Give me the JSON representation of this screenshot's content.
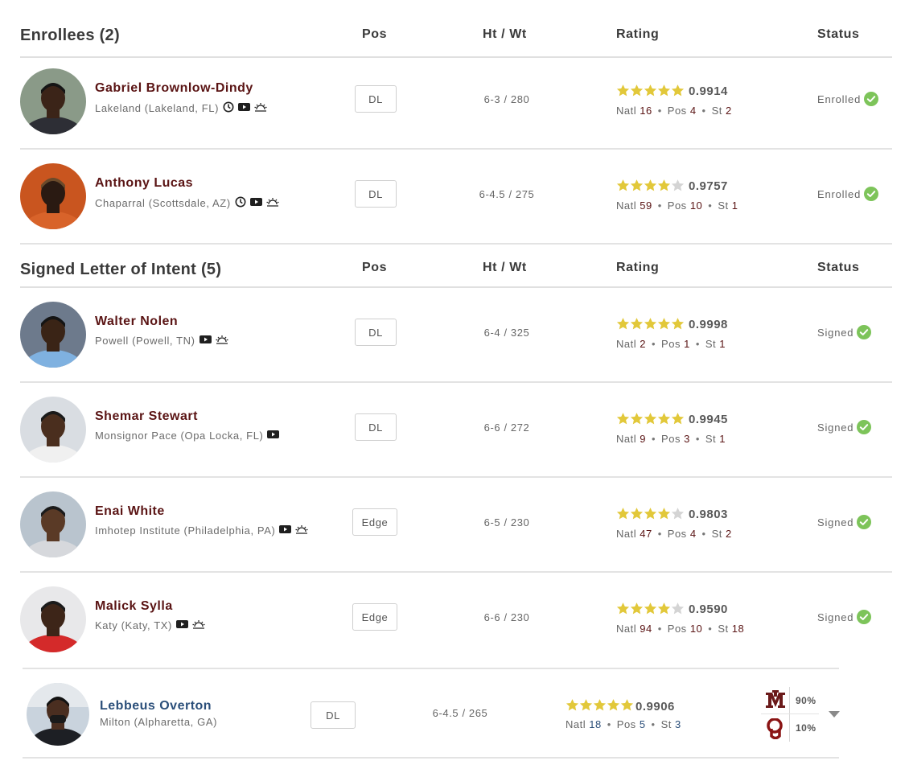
{
  "sections": [
    {
      "title": "Enrollees (2)",
      "columns": {
        "pos": "Pos",
        "htwt": "Ht / Wt",
        "rating": "Rating",
        "status": "Status"
      }
    },
    {
      "title": "Signed Letter of Intent (5)",
      "columns": {
        "pos": "Pos",
        "htwt": "Ht / Wt",
        "rating": "Rating",
        "status": "Status"
      }
    }
  ],
  "players": [
    {
      "name": "Gabriel Brownlow-Dindy",
      "school": "Lakeland (Lakeland, FL)",
      "icons": [
        "clock-icon",
        "video-icon",
        "sunrise-icon"
      ],
      "pos": "DL",
      "htwt": "6-3 / 280",
      "stars": 5,
      "score": "0.9914",
      "natl_label": "Natl",
      "natl": "16",
      "pos_label": "Pos",
      "pos_rank": "4",
      "st_label": "St",
      "st": "2",
      "status": "Enrolled"
    },
    {
      "name": "Anthony Lucas",
      "school": "Chaparral (Scottsdale, AZ)",
      "icons": [
        "clock-icon",
        "video-icon",
        "sunrise-icon"
      ],
      "pos": "DL",
      "htwt": "6-4.5 / 275",
      "stars": 4,
      "score": "0.9757",
      "natl_label": "Natl",
      "natl": "59",
      "pos_label": "Pos",
      "pos_rank": "10",
      "st_label": "St",
      "st": "1",
      "status": "Enrolled"
    },
    {
      "name": "Walter Nolen",
      "school": "Powell (Powell, TN)",
      "icons": [
        "video-icon",
        "sunrise-icon"
      ],
      "pos": "DL",
      "htwt": "6-4 / 325",
      "stars": 5,
      "score": "0.9998",
      "natl_label": "Natl",
      "natl": "2",
      "pos_label": "Pos",
      "pos_rank": "1",
      "st_label": "St",
      "st": "1",
      "status": "Signed"
    },
    {
      "name": "Shemar Stewart",
      "school": "Monsignor Pace (Opa Locka, FL)",
      "icons": [
        "video-icon"
      ],
      "pos": "DL",
      "htwt": "6-6 / 272",
      "stars": 5,
      "score": "0.9945",
      "natl_label": "Natl",
      "natl": "9",
      "pos_label": "Pos",
      "pos_rank": "3",
      "st_label": "St",
      "st": "1",
      "status": "Signed"
    },
    {
      "name": "Enai White",
      "school": "Imhotep Institute (Philadelphia, PA)",
      "icons": [
        "video-icon",
        "sunrise-icon"
      ],
      "pos": "Edge",
      "htwt": "6-5 / 230",
      "stars": 4,
      "score": "0.9803",
      "natl_label": "Natl",
      "natl": "47",
      "pos_label": "Pos",
      "pos_rank": "4",
      "st_label": "St",
      "st": "2",
      "status": "Signed"
    },
    {
      "name": "Malick Sylla",
      "school": "Katy (Katy, TX)",
      "icons": [
        "video-icon",
        "sunrise-icon"
      ],
      "pos": "Edge",
      "htwt": "6-6 / 230",
      "stars": 4,
      "score": "0.9590",
      "natl_label": "Natl",
      "natl": "94",
      "pos_label": "Pos",
      "pos_rank": "10",
      "st_label": "St",
      "st": "18",
      "status": "Signed"
    }
  ],
  "prospect": {
    "name": "Lebbeus Overton",
    "school": "Milton (Alpharetta, GA)",
    "pos": "DL",
    "htwt": "6-4.5 / 265",
    "stars": 5,
    "score": "0.9906",
    "natl_label": "Natl",
    "natl": "18",
    "pos_label": "Pos",
    "pos_rank": "5",
    "st_label": "St",
    "st": "3",
    "predictions": [
      {
        "team_logo": "texas-am-logo",
        "logo_text": "ATM",
        "pct": "90%"
      },
      {
        "team_logo": "oklahoma-logo",
        "logo_text": "OU",
        "pct": "10%"
      }
    ]
  },
  "colors": {
    "star_gold": "#e2c83a",
    "star_empty": "#d4d4d4",
    "check_green": "#7dc45a",
    "maroon_name": "#5a1414",
    "blue_name": "#2b4f7a",
    "texas_am_maroon": "#6b1a1a",
    "oklahoma_crimson": "#8a1414"
  }
}
